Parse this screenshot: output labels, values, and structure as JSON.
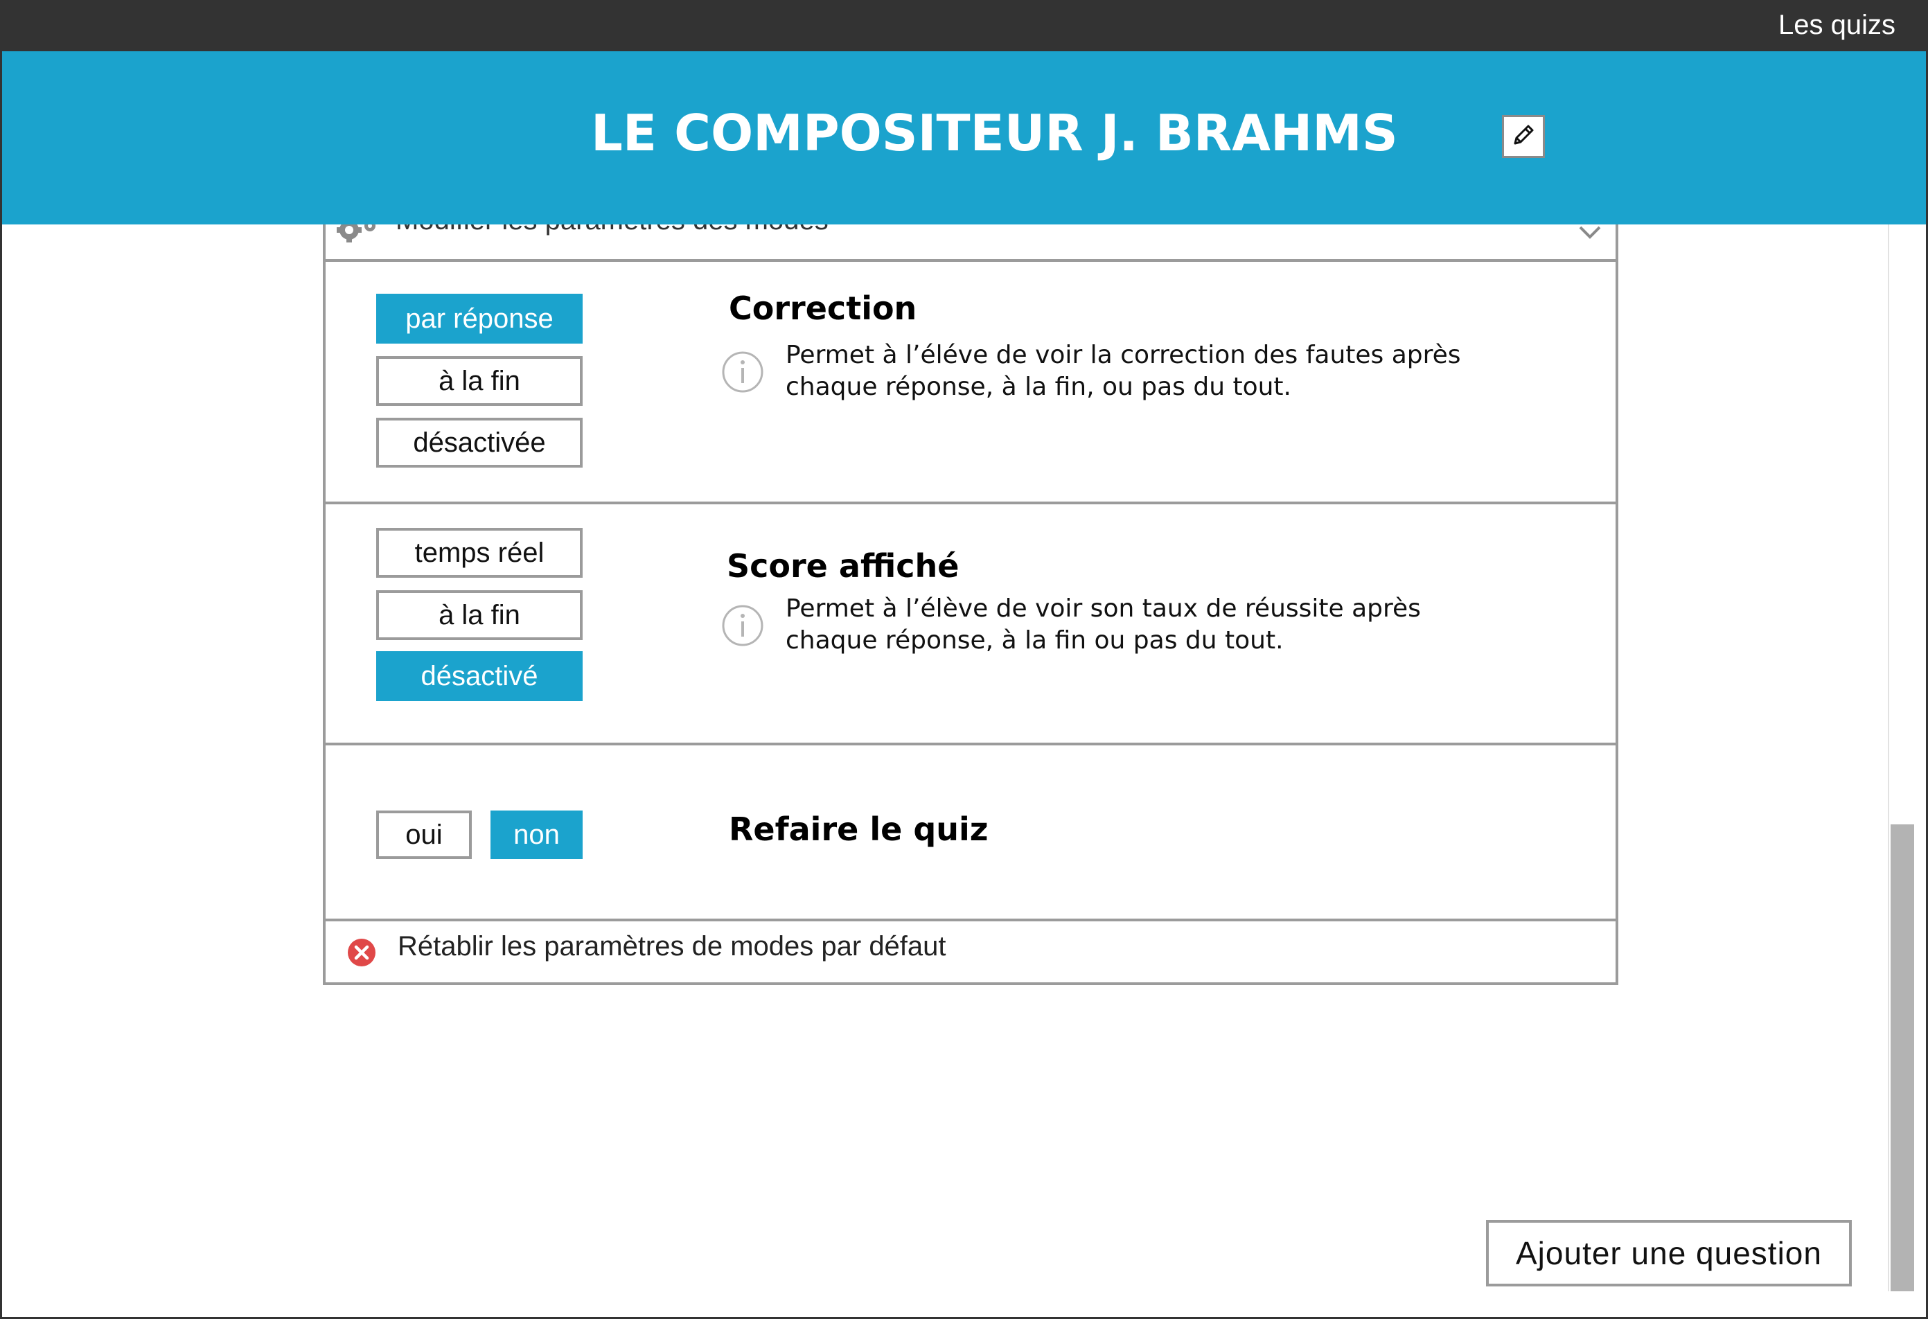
{
  "topbar": {
    "link_label": "Les quizs"
  },
  "header": {
    "title": "LE COMPOSITEUR J. BRAHMS",
    "edit_icon": "pencil-icon",
    "color": "#1ba3cd"
  },
  "panel": {
    "header_label": "Modifier les paramètres des modes",
    "header_icon": "gear-icon",
    "sections": {
      "correction": {
        "title": "Correction",
        "description_line1": "Permet à l’éléve de voir la correction des fautes après",
        "description_line2": "chaque réponse, à la fin, ou pas du tout.",
        "options": [
          "par réponse",
          "à la fin",
          "désactivée"
        ],
        "selected": "par réponse"
      },
      "score": {
        "title": "Score affiché",
        "description_line1": "Permet à l’élève de voir son taux de réussite après",
        "description_line2": "chaque réponse, à la fin ou pas du tout.",
        "options": [
          "temps réel",
          "à la fin",
          "désactivé"
        ],
        "selected": "désactivé"
      },
      "retake": {
        "title": "Refaire le quiz",
        "options": [
          "oui",
          "non"
        ],
        "selected": "non"
      }
    },
    "reset_label": "Rétablir les paramètres de modes par défaut",
    "reset_icon": "close-circle-icon"
  },
  "footer": {
    "add_question_label": "Ajouter une question"
  }
}
